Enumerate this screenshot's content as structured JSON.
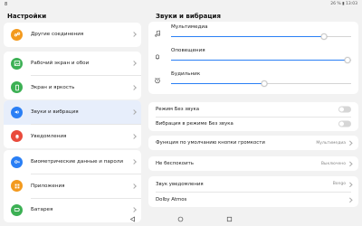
{
  "status_bar": {
    "left": "8",
    "right": "26 % ▮ 13:03"
  },
  "left_panel": {
    "title": "Настройки",
    "items": [
      {
        "label": "Другие соединения",
        "icon": "link-icon",
        "color": "#f39a1e"
      },
      {
        "label": "Рабочий экран и обои",
        "icon": "image-icon",
        "color": "#3cb054"
      },
      {
        "label": "Экран и яркость",
        "icon": "phone-screen-icon",
        "color": "#3cb054"
      },
      {
        "label": "Звуки и вибрация",
        "icon": "speaker-icon",
        "color": "#2a7ff5",
        "selected": true
      },
      {
        "label": "Уведомления",
        "icon": "bell-icon",
        "color": "#e94b3c"
      },
      {
        "label": "Биометрические данные и пароли",
        "icon": "key-icon",
        "color": "#2a7ff5"
      },
      {
        "label": "Приложения",
        "icon": "apps-icon",
        "color": "#f39a1e"
      },
      {
        "label": "Батарея",
        "icon": "battery-icon",
        "color": "#3cb054"
      }
    ]
  },
  "right_panel": {
    "title": "Звуки и вибрация",
    "volumes": [
      {
        "label": "Мультимедиа",
        "icon": "music-note-icon",
        "level": 0.85
      },
      {
        "label": "Оповещения",
        "icon": "bell-outline-icon",
        "level": 0.98
      },
      {
        "label": "Будильник",
        "icon": "alarm-icon",
        "level": 0.52
      }
    ],
    "toggles": [
      {
        "label": "Режим Без звука",
        "on": false
      },
      {
        "label": "Вибрация в режиме Без звука",
        "on": false
      }
    ],
    "volume_button": {
      "label": "Функция по умолчанию кнопки громкости",
      "value": "Мультимедиа"
    },
    "dnd": {
      "label": "Не беспокоить",
      "value": "Выключено"
    },
    "notification_sound": {
      "label": "Звук уведомления",
      "value": "Bongo"
    },
    "dolby": {
      "label": "Dolby Atmos",
      "value": ""
    }
  },
  "colors": {
    "accent": "#2a7ff5",
    "selected_bg": "#e7eefb"
  },
  "nav_bar": {
    "back": "back-icon",
    "home": "home-icon",
    "recents": "recents-icon"
  }
}
